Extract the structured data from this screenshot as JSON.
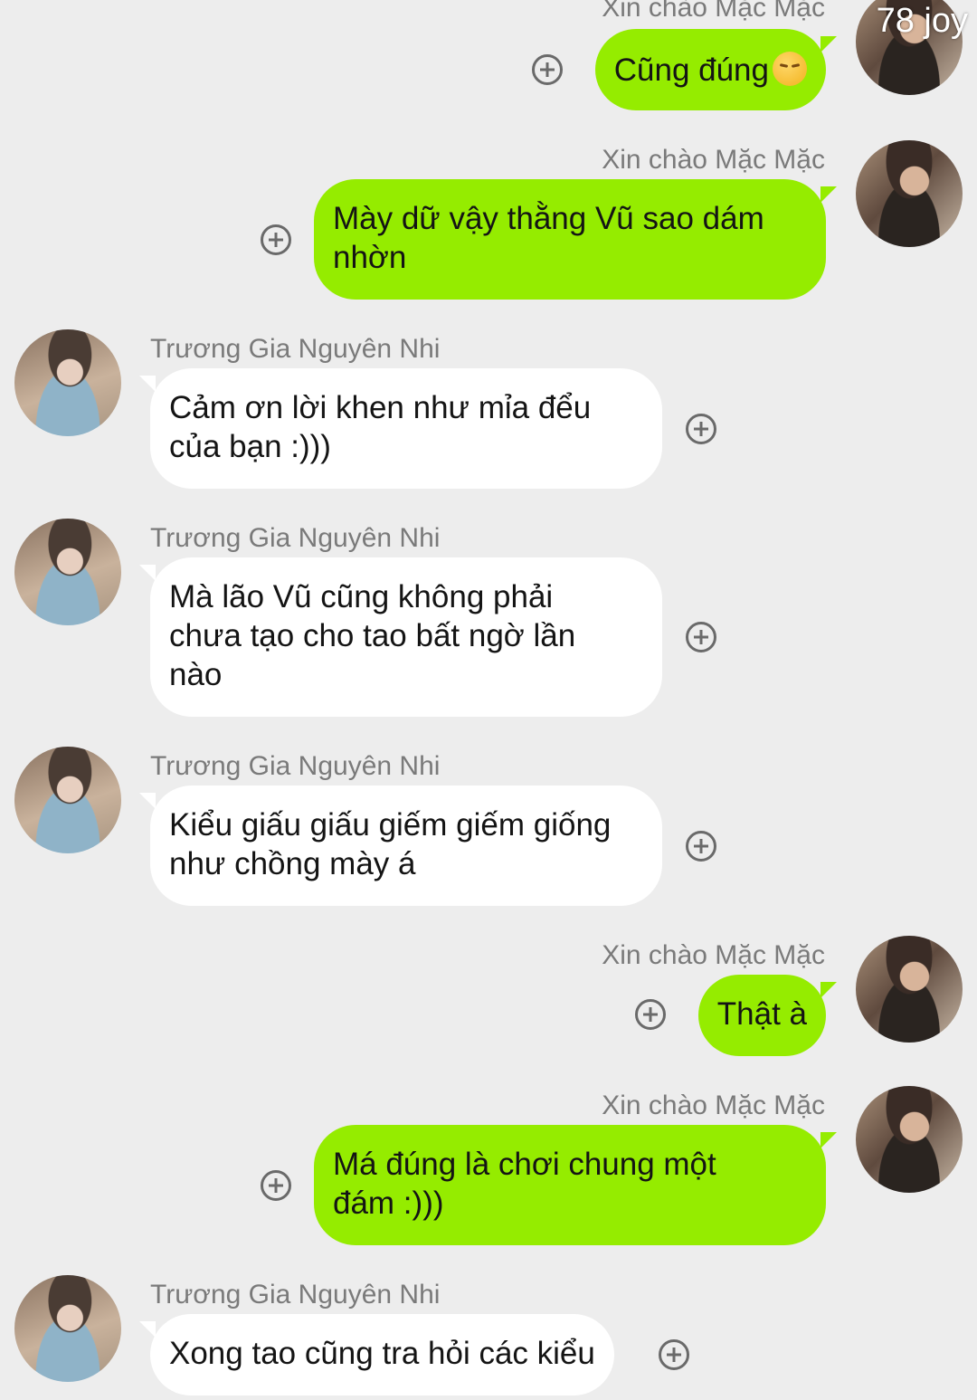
{
  "watermark": "78 joy",
  "messages": [
    {
      "from": "me",
      "sender": "Xin chào Mặc Mặc",
      "text": "Cũng đúng",
      "emoji": "pensive-face-emoji"
    },
    {
      "from": "me",
      "sender": "Xin chào Mặc Mặc",
      "text": "Mày dữ vậy thằng Vũ sao dám\nnhờn"
    },
    {
      "from": "them",
      "sender": "Trương Gia Nguyên Nhi",
      "text": "Cảm ơn lời khen như mỉa đểu\ncủa bạn :)))"
    },
    {
      "from": "them",
      "sender": "Trương Gia Nguyên Nhi",
      "text": "Mà lão Vũ cũng không phải\nchưa tạo cho tao bất ngờ lần\nnào"
    },
    {
      "from": "them",
      "sender": "Trương Gia Nguyên Nhi",
      "text": "Kiểu giấu giấu giếm giếm giống\nnhư chồng mày á"
    },
    {
      "from": "me",
      "sender": "Xin chào Mặc Mặc",
      "text": "Thật à"
    },
    {
      "from": "me",
      "sender": "Xin chào Mặc Mặc",
      "text": "Má đúng là chơi chung một\nđám :)))"
    },
    {
      "from": "them",
      "sender": "Trương Gia Nguyên Nhi",
      "text": "Xong tao cũng tra hỏi các kiểu"
    }
  ]
}
